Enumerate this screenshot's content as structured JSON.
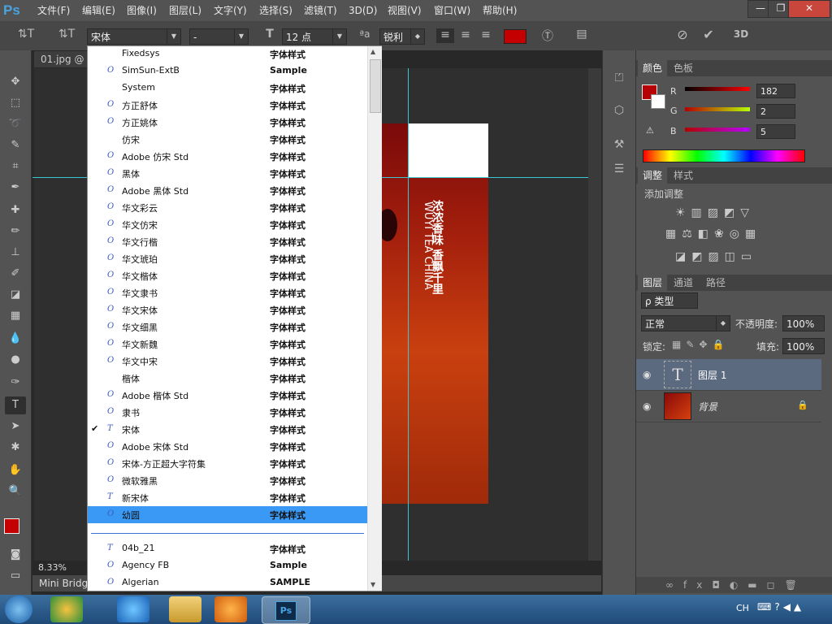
{
  "app": {
    "logo": "Ps"
  },
  "menubar": {
    "items": [
      "文件(F)",
      "编辑(E)",
      "图像(I)",
      "图层(L)",
      "文字(Y)",
      "选择(S)",
      "滤镜(T)",
      "3D(D)",
      "视图(V)",
      "窗口(W)",
      "帮助(H)"
    ],
    "minimize": "—",
    "restore": "❐",
    "close": "✕"
  },
  "options": {
    "font_family": "宋体",
    "font_style": "-",
    "font_size": "12 点",
    "aa_label": "ªa",
    "antialias": "锐利",
    "color_swatch": "#c40000",
    "tt_icon": "T",
    "orient_icon": "⇅T"
  },
  "document": {
    "tab": "01.jpg @ 8",
    "zoom": "8.33%",
    "minibridge": "Mini Bridge"
  },
  "artwork": {
    "title_cn": "浓浓香味 香飘千里",
    "title_en": "WUYI TEA CHINA"
  },
  "color_panel": {
    "tabs": [
      "颜色",
      "色板"
    ],
    "r_label": "R",
    "g_label": "G",
    "b_label": "B",
    "r": "182",
    "g": "2",
    "b": "5",
    "fg_color": "#b60205"
  },
  "adjust_panel": {
    "tabs": [
      "调整",
      "样式"
    ],
    "add_label": "添加调整"
  },
  "layers_panel": {
    "tabs": [
      "图层",
      "通道",
      "路径"
    ],
    "filter_kind": "ρ 类型",
    "blend_mode": "正常",
    "opacity_label": "不透明度:",
    "opacity": "100%",
    "lock_label": "锁定:",
    "fill_label": "填充:",
    "fill": "100%",
    "layers": [
      {
        "name": "图层 1",
        "type": "text"
      },
      {
        "name": "背景",
        "type": "image"
      }
    ]
  },
  "fontlist": {
    "fonts": [
      {
        "name": "Fixedsys",
        "sample": "字体样式",
        "icon": ""
      },
      {
        "name": "SimSun-ExtB",
        "sample": "Sample",
        "icon": "O"
      },
      {
        "name": "System",
        "sample": "字体样式",
        "icon": ""
      },
      {
        "name": "方正舒体",
        "sample": "字体样式",
        "icon": "O"
      },
      {
        "name": "方正姚体",
        "sample": "字体样式",
        "icon": "O"
      },
      {
        "name": "仿宋",
        "sample": "字体样式",
        "icon": ""
      },
      {
        "name": "Adobe 仿宋 Std",
        "sample": "字体样式",
        "icon": "O"
      },
      {
        "name": "黑体",
        "sample": "字体样式",
        "icon": "O"
      },
      {
        "name": "Adobe 黑体 Std",
        "sample": "字体样式",
        "icon": "O"
      },
      {
        "name": "华文彩云",
        "sample": "字体样式",
        "icon": "O"
      },
      {
        "name": "华文仿宋",
        "sample": "字体样式",
        "icon": "O"
      },
      {
        "name": "华文行楷",
        "sample": "字体样式",
        "icon": "O"
      },
      {
        "name": "华文琥珀",
        "sample": "字体样式",
        "icon": "O"
      },
      {
        "name": "华文楷体",
        "sample": "字体样式",
        "icon": "O"
      },
      {
        "name": "华文隶书",
        "sample": "字体样式",
        "icon": "O"
      },
      {
        "name": "华文宋体",
        "sample": "字体样式",
        "icon": "O"
      },
      {
        "name": "华文细黑",
        "sample": "字体样式",
        "icon": "O"
      },
      {
        "name": "华文新魏",
        "sample": "字体样式",
        "icon": "O"
      },
      {
        "name": "华文中宋",
        "sample": "字体样式",
        "icon": "O"
      },
      {
        "name": "楷体",
        "sample": "字体样式",
        "icon": ""
      },
      {
        "name": "Adobe 楷体 Std",
        "sample": "字体样式",
        "icon": "O"
      },
      {
        "name": "隶书",
        "sample": "字体样式",
        "icon": "O"
      },
      {
        "name": "宋体",
        "sample": "字体样式",
        "icon": "T",
        "checked": true
      },
      {
        "name": "Adobe 宋体 Std",
        "sample": "字体样式",
        "icon": "O"
      },
      {
        "name": "宋体-方正超大字符集",
        "sample": "字体样式",
        "icon": "O"
      },
      {
        "name": "微软雅黑",
        "sample": "字体样式",
        "icon": "O"
      },
      {
        "name": "新宋体",
        "sample": "字体样式",
        "icon": "T"
      },
      {
        "name": "幼圆",
        "sample": "字体样式",
        "icon": "O",
        "selected": true
      }
    ],
    "fonts2": [
      {
        "name": "04b_21",
        "sample": "字体样式",
        "icon": "T"
      },
      {
        "name": "Agency FB",
        "sample": "Sample",
        "icon": "O"
      },
      {
        "name": "Algerian",
        "sample": "SAMPLE",
        "icon": "O"
      }
    ],
    "check": "✔"
  },
  "taskbar": {
    "lang": "CH"
  }
}
